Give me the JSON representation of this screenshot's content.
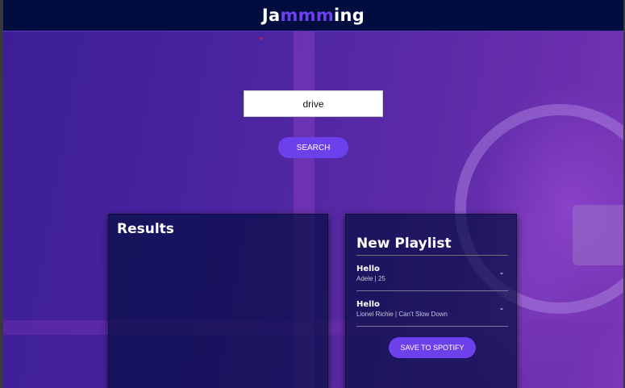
{
  "header": {
    "logo_prefix": "Ja",
    "logo_accent": "mmm",
    "logo_suffix": "ing"
  },
  "search": {
    "value": "drive",
    "button_label": "SEARCH"
  },
  "results": {
    "title": "Results"
  },
  "playlist": {
    "name": "New Playlist",
    "tracks": [
      {
        "title": "Hello",
        "info": "Adele | 25",
        "action": "-"
      },
      {
        "title": "Hello",
        "info": "Lionel Richie | Can't Slow Down",
        "action": "-"
      }
    ],
    "save_label": "SAVE TO SPOTIFY"
  },
  "colors": {
    "header_bg": "#010c3f",
    "accent": "#6c41ec",
    "panel_bg": "#010c3f"
  }
}
